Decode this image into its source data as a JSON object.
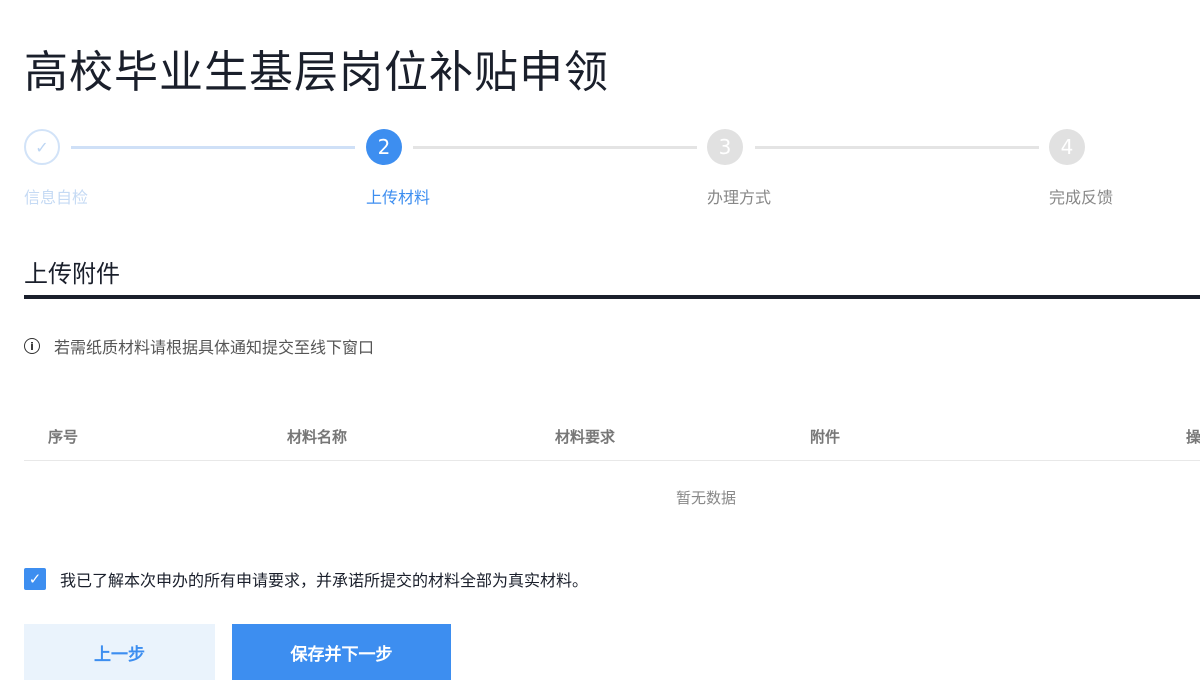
{
  "title": "高校毕业生基层岗位补贴申领",
  "steps": [
    {
      "label": "信息自检",
      "num": "✓"
    },
    {
      "label": "上传材料",
      "num": "2"
    },
    {
      "label": "办理方式",
      "num": "3"
    },
    {
      "label": "完成反馈",
      "num": "4"
    }
  ],
  "section_title": "上传附件",
  "tip": "若需纸质材料请根据具体通知提交至线下窗口",
  "tip_icon": "i",
  "table": {
    "headers": [
      "序号",
      "材料名称",
      "材料要求",
      "附件",
      "操作"
    ],
    "empty": "暂无数据"
  },
  "agreement": {
    "checked": true,
    "text": "我已了解本次申办的所有申请要求，并承诺所提交的材料全部为真实材料。"
  },
  "buttons": {
    "prev": "上一步",
    "next": "保存并下一步"
  },
  "colors": {
    "accent": "#3d8ef0",
    "done": "#c9def7",
    "pending": "#e1e1e1"
  }
}
